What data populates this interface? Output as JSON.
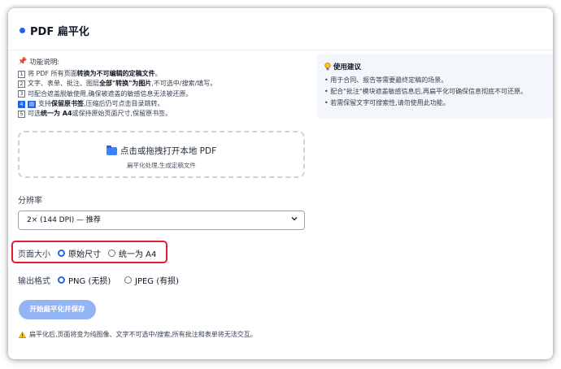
{
  "header": {
    "title": "PDF 扁平化"
  },
  "features": {
    "heading": "功能说明:",
    "lines": [
      {
        "num": "1",
        "pre": "将 PDF 所有页面",
        "bold": "转换为不可编辑的定稿文件",
        "post": "。"
      },
      {
        "num": "2",
        "pre": "文字、表单、批注、图层",
        "bold": "全部\"转换\"为图片",
        "post": ",不可选中/搜索/填写。"
      },
      {
        "num": "3",
        "pre": "可配合遮盖脱敏使用,确保被遮盖的敏感信息无法被还原。",
        "bold": "",
        "post": ""
      },
      {
        "num": "4",
        "pre": "支持",
        "bold": "保留原书签",
        "post": ",压缩后仍可点击目录跳转。"
      },
      {
        "num": "5",
        "pre": "可选",
        "bold": "统一为 A4",
        "post": " 或保持原始页面尺寸,保留原书签。"
      }
    ]
  },
  "dropzone": {
    "main": "点击或拖拽打开本地 PDF",
    "sub": "扁平化处理,生成定稿文件"
  },
  "resolution": {
    "label": "分辨率",
    "selected": "2× (144 DPI) — 推荐"
  },
  "page_size": {
    "label": "页面大小",
    "options": [
      "原始尺寸",
      "统一为 A4"
    ],
    "selected": "原始尺寸"
  },
  "output_format": {
    "label": "输出格式",
    "options": [
      "PNG (无损)",
      "JPEG (有损)"
    ],
    "selected": "PNG (无损)"
  },
  "action": {
    "label": "开始扁平化并保存"
  },
  "warning": {
    "text": "扁平化后,页面将变为纯图像、文字不可选中/搜索,所有批注和表单将无法交互。"
  },
  "tips": {
    "heading": "使用建议",
    "items": [
      "• 用于合同、报告等需要最终定稿的场景。",
      "• 配合\"批注\"模块遮盖敏感信息后,再扁平化可确保信息彻底不可还原。",
      "• 若需保留文字可搜索性,请勿使用此功能。"
    ]
  },
  "colors": {
    "accent": "#2563eb",
    "highlight": "#e11d2e",
    "button": "#93b4f5"
  }
}
